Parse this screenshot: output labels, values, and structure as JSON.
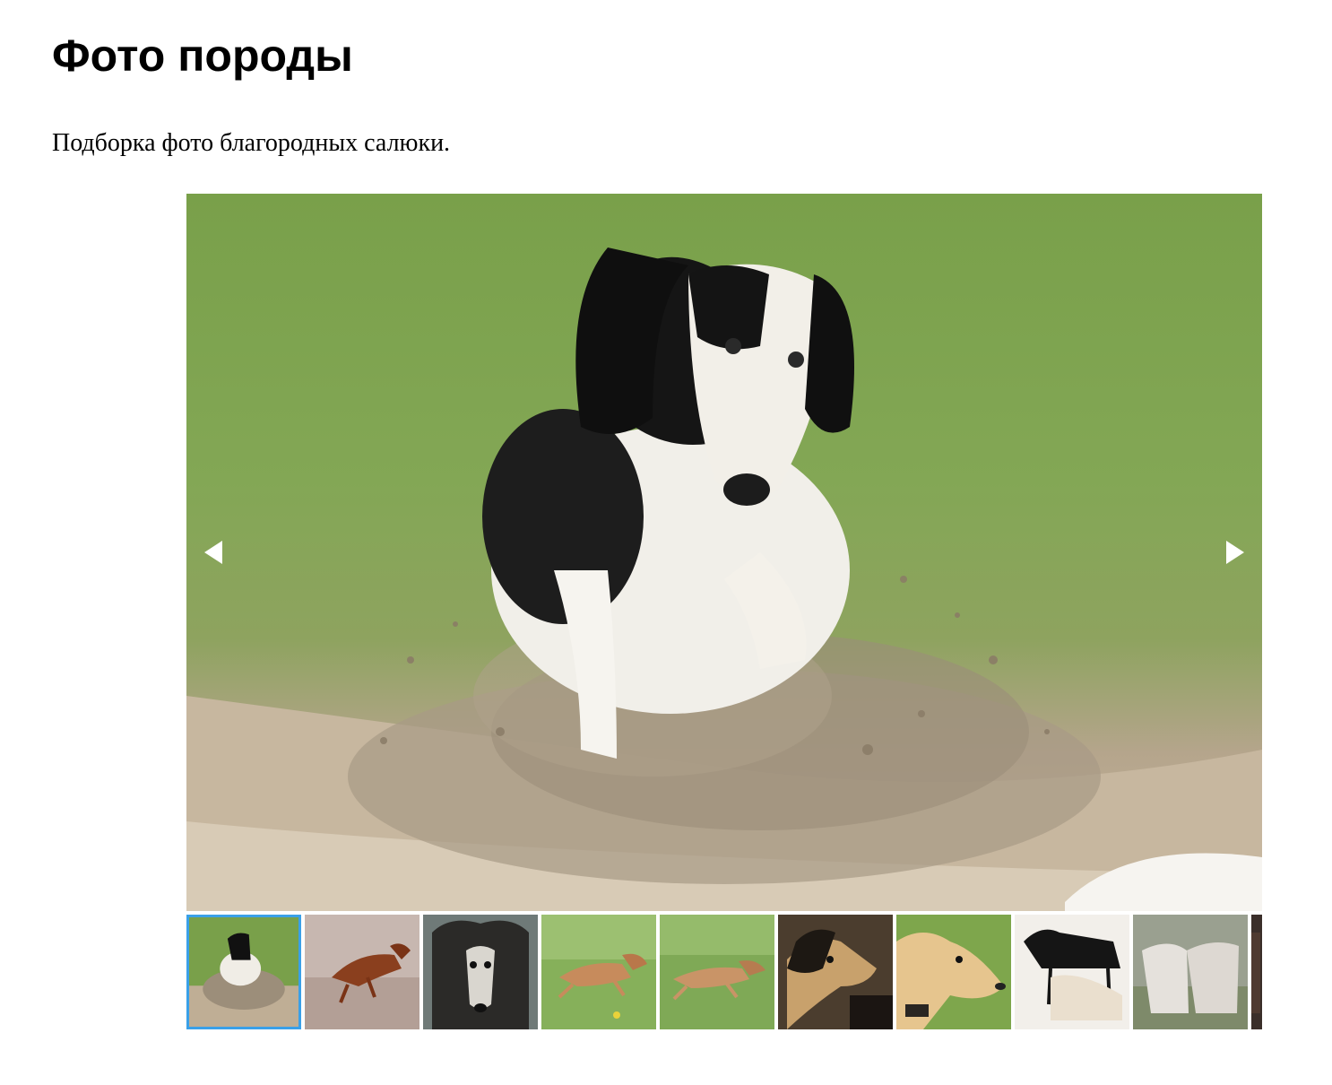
{
  "page": {
    "title": "Фото породы",
    "intro": "Подборка фото благородных салюки."
  },
  "gallery": {
    "main_photo_icon": "saluki-running-in-sand-photo",
    "prev_icon": "triangle-left-icon",
    "next_icon": "triangle-right-icon",
    "active_thumb_color": "#3aa0e8",
    "selected_index": 0,
    "thumbnails": [
      {
        "icon": "black-white-saluki-sand-photo"
      },
      {
        "icon": "red-saluki-running-wet-sand-photo"
      },
      {
        "icon": "black-tan-saluki-portrait-photo"
      },
      {
        "icon": "cream-saluki-running-grass-photo"
      },
      {
        "icon": "cream-saluki-running-grass-photo-2"
      },
      {
        "icon": "black-tan-saluki-head-photo"
      },
      {
        "icon": "golden-saluki-head-photo"
      },
      {
        "icon": "two-salukis-studio-photo"
      },
      {
        "icon": "white-salukis-park-photo"
      },
      {
        "icon": "partial-thumbnail-photo"
      }
    ]
  }
}
